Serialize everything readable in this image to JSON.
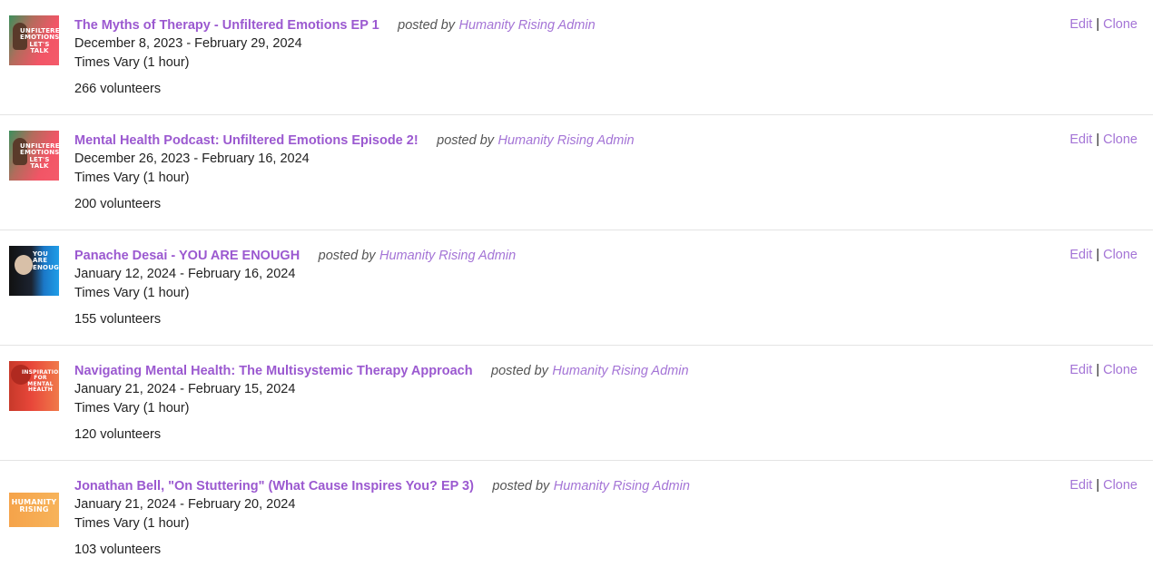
{
  "events": [
    {
      "title": "The Myths of Therapy - Unfiltered Emotions EP 1",
      "posted_by_label": "posted by",
      "author": "Humanity Rising Admin",
      "dates": "December 8, 2023 - February 29, 2024",
      "times": "Times Vary (1 hour)",
      "volunteers": "266 volunteers",
      "edit": "Edit",
      "separator": "|",
      "clone": "Clone",
      "thumb_text": "UNFILTERED EMOTIONS LET'S TALK"
    },
    {
      "title": "Mental Health Podcast: Unfiltered Emotions Episode 2!",
      "posted_by_label": "posted by",
      "author": "Humanity Rising Admin",
      "dates": "December 26, 2023 - February 16, 2024",
      "times": "Times Vary (1 hour)",
      "volunteers": "200 volunteers",
      "edit": "Edit",
      "separator": "|",
      "clone": "Clone",
      "thumb_text": "UNFILTERED EMOTIONS LET'S TALK"
    },
    {
      "title": "Panache Desai - YOU ARE ENOUGH",
      "posted_by_label": "posted by",
      "author": "Humanity Rising Admin",
      "dates": "January 12, 2024 - February 16, 2024",
      "times": "Times Vary (1 hour)",
      "volunteers": "155 volunteers",
      "edit": "Edit",
      "separator": "|",
      "clone": "Clone",
      "thumb_text": "YOU ARE ENOUGH"
    },
    {
      "title": "Navigating Mental Health: The Multisystemic Therapy Approach",
      "posted_by_label": "posted by",
      "author": "Humanity Rising Admin",
      "dates": "January 21, 2024 - February 15, 2024",
      "times": "Times Vary (1 hour)",
      "volunteers": "120 volunteers",
      "edit": "Edit",
      "separator": "|",
      "clone": "Clone",
      "thumb_text": "INSPIRATION FOR MENTAL HEALTH"
    },
    {
      "title": "Jonathan Bell, \"On Stuttering\" (What Cause Inspires You? EP 3)",
      "posted_by_label": "posted by",
      "author": "Humanity Rising Admin",
      "dates": "January 21, 2024 - February 20, 2024",
      "times": "Times Vary (1 hour)",
      "volunteers": "103 volunteers",
      "edit": "Edit",
      "separator": "|",
      "clone": "Clone",
      "thumb_text": "HUMANITY RISING"
    }
  ],
  "colors": {
    "link_purple": "#9b59d0",
    "author_purple": "#a474d6",
    "divider": "#e4e4e4"
  }
}
